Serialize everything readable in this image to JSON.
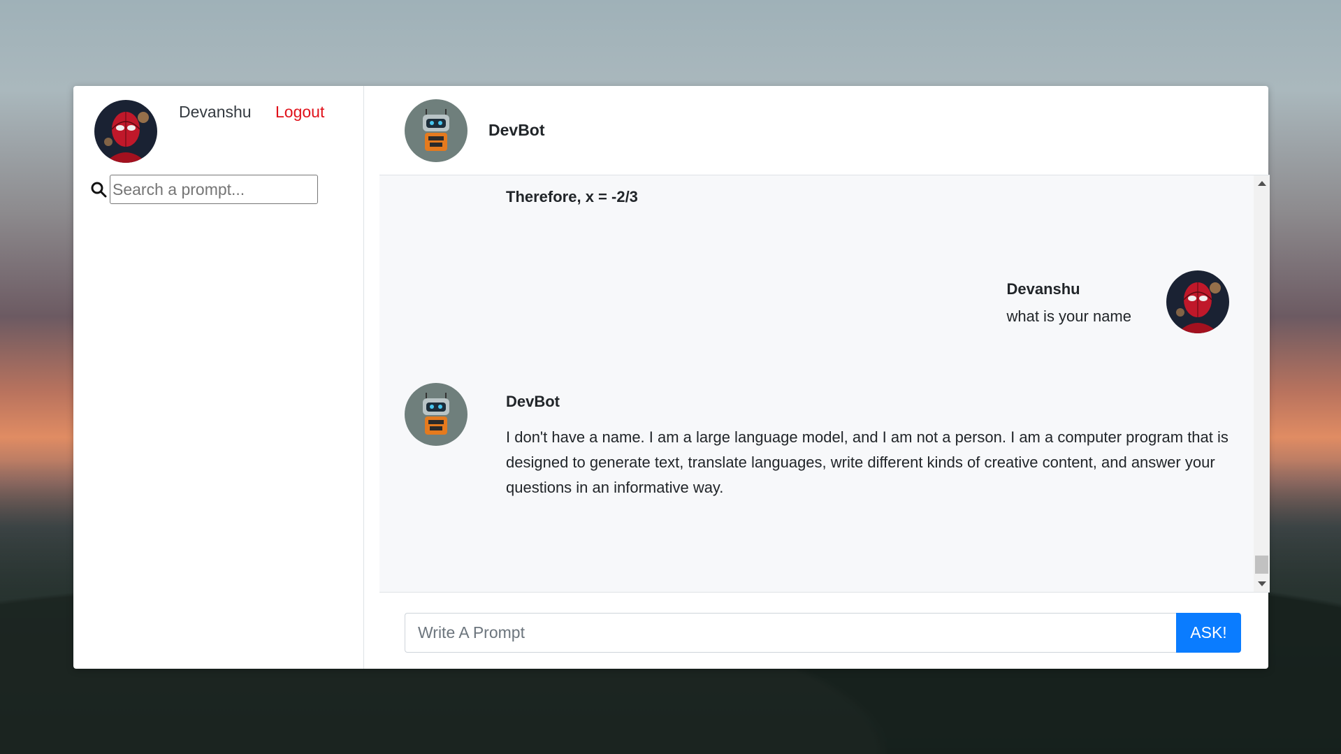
{
  "sidebar": {
    "user_name": "Devanshu",
    "logout_label": "Logout",
    "search_placeholder": "Search a prompt..."
  },
  "chat": {
    "header_title": "DevBot",
    "previous_text": "Therefore, x = -2/3",
    "messages": [
      {
        "sender": "Devanshu",
        "text": "what is your name"
      },
      {
        "sender": "DevBot",
        "text": "I don't have a name. I am a large language model, and I am not a person. I am a computer program that is designed to generate text, translate languages, write different kinds of creative content, and answer your questions in an informative way."
      }
    ]
  },
  "prompt": {
    "placeholder": "Write A Prompt",
    "ask_label": "ASK!"
  },
  "colors": {
    "logout": "#e0111a",
    "ask_button": "#0a7cff",
    "chat_background": "#f7f8fa"
  },
  "icons": {
    "search": "search-icon",
    "user_avatar": "spiderman-avatar",
    "bot_avatar": "robot-avatar"
  }
}
